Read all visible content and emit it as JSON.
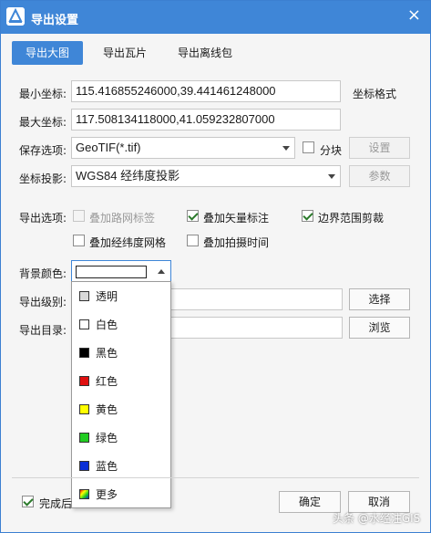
{
  "window": {
    "title": "导出设置",
    "close_glyph": "×"
  },
  "tabs": [
    {
      "label": "导出大图",
      "active": true
    },
    {
      "label": "导出瓦片",
      "active": false
    },
    {
      "label": "导出离线包",
      "active": false
    }
  ],
  "form": {
    "min_coord": {
      "label": "最小坐标:",
      "value": "115.416855246000,39.441461248000"
    },
    "max_coord": {
      "label": "最大坐标:",
      "value": "117.508134118000,41.059232807000"
    },
    "coord_format_label": "坐标格式",
    "save_option": {
      "label": "保存选项:",
      "value": "GeoTIF(*.tif)"
    },
    "tiling": {
      "label": "分块",
      "checked": false
    },
    "settings_button": "设置",
    "projection": {
      "label": "坐标投影:",
      "value": "WGS84 经纬度投影"
    },
    "params_button": "参数",
    "export_options": {
      "label": "导出选项:",
      "items": [
        {
          "label": "叠加路网标签",
          "checked": false,
          "disabled": true
        },
        {
          "label": "叠加矢量标注",
          "checked": true,
          "disabled": false
        },
        {
          "label": "边界范围剪裁",
          "checked": true,
          "disabled": false
        },
        {
          "label": "叠加经纬度网格",
          "checked": false,
          "disabled": false
        },
        {
          "label": "叠加拍摄时间",
          "checked": false,
          "disabled": false
        }
      ]
    },
    "bg_color": {
      "label": "背景颜色:",
      "selected": "white"
    },
    "export_level": {
      "label": "导出级别:",
      "value": ""
    },
    "select_button": "选择",
    "export_dir": {
      "label": "导出目录:",
      "value": ""
    },
    "browse_button": "浏览"
  },
  "color_options": [
    {
      "label": "透明",
      "color": "#d9d9d9"
    },
    {
      "label": "白色",
      "color": "#ffffff"
    },
    {
      "label": "黑色",
      "color": "#000000"
    },
    {
      "label": "红色",
      "color": "#e01010"
    },
    {
      "label": "黄色",
      "color": "#ffff00"
    },
    {
      "label": "绿色",
      "color": "#22cc22"
    },
    {
      "label": "蓝色",
      "color": "#0a2fd6"
    },
    {
      "label": "更多",
      "color": "multi"
    }
  ],
  "footer": {
    "done_checkbox": {
      "label": "完成后",
      "checked": true
    },
    "ok_button": "确定",
    "cancel_button": "取消"
  },
  "watermark": "头条 @水经注GIS",
  "colors": {
    "accent": "#3f86d7"
  }
}
